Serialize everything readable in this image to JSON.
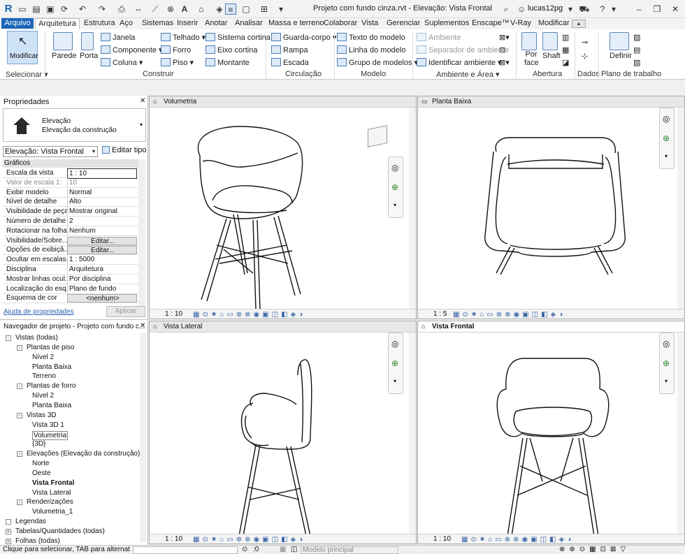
{
  "app": {
    "title": "Projeto com fundo cinza.rvt - Elevação: Vista Frontal",
    "user": "lucas12pg"
  },
  "menu": [
    "Arquivo",
    "Arquitetura",
    "Estrutura",
    "Aço",
    "Sistemas",
    "Inserir",
    "Anotar",
    "Analisar",
    "Massa e terreno",
    "Colaborar",
    "Vista",
    "Gerenciar",
    "Suplementos",
    "Enscape™",
    "V-Ray",
    "Modificar"
  ],
  "ribbon": {
    "modify": "Modificar",
    "select_group": "Selecionar",
    "wall": "Parede",
    "door": "Porta",
    "window": "Janela",
    "component": "Componente",
    "column": "Coluna",
    "roof": "Telhado",
    "ceiling": "Forro",
    "floor": "Piso",
    "curtain_system": "Sistema cortina",
    "curtain_grid": "Eixo cortina",
    "mullion": "Montante",
    "railing": "Guarda-corpo",
    "ramp": "Rampa",
    "stair": "Escada",
    "model_text": "Texto do modelo",
    "model_line": "Linha do modelo",
    "model_group": "Grupo de modelos",
    "room": "Ambiente",
    "room_separator": "Separador de ambiente",
    "tag_room": "Identificar ambiente",
    "by_face": "Por face",
    "shaft": "Shaft",
    "set": "Definir",
    "groups": {
      "build": "Construir",
      "circulation": "Circulação",
      "model": "Modelo",
      "room_area": "Ambiente e Área",
      "opening": "Abertura",
      "datum": "Dados",
      "work_plane": "Plano de trabalho"
    }
  },
  "properties": {
    "title": "Propriedades",
    "type_line1": "Elevação",
    "type_line2": "Elevação da construção",
    "selector": "Elevação: Vista Frontal",
    "edit_type": "Editar tipo",
    "section": "Gráficos",
    "rows": [
      {
        "k": "Escala da vista",
        "v": "1 : 10"
      },
      {
        "k": "Valor de escala   1:",
        "v": "10"
      },
      {
        "k": "Exibir modelo",
        "v": "Normal"
      },
      {
        "k": "Nível de detalhe",
        "v": "Alto"
      },
      {
        "k": "Visibilidade de peças",
        "v": "Mostrar original"
      },
      {
        "k": "Número de detalhe",
        "v": "2"
      },
      {
        "k": "Rotacionar na folha",
        "v": "Nenhum"
      },
      {
        "k": "Visibilidade/Sobre...",
        "v": "Editar..."
      },
      {
        "k": "Opções de exibiçã...",
        "v": "Editar..."
      },
      {
        "k": "Ocultar em escalas...",
        "v": "1 : 5000"
      },
      {
        "k": "Disciplina",
        "v": "Arquitetura"
      },
      {
        "k": "Mostrar linhas ocul...",
        "v": "Por disciplina"
      },
      {
        "k": "Localização do esq...",
        "v": "Plano de fundo"
      },
      {
        "k": "Esquema de cor",
        "v": "<nenhum>"
      }
    ],
    "help_link": "Ajuda de propriedades",
    "apply": "Aplicar"
  },
  "navigator": {
    "title": "Navegador de projeto - Projeto com fundo c...",
    "items": [
      {
        "label": "Vistas (todas)",
        "level": 0,
        "toggle": "-"
      },
      {
        "label": "Plantas de piso",
        "level": 1,
        "toggle": "-"
      },
      {
        "label": "Nível 2",
        "level": 2
      },
      {
        "label": "Planta Baixa",
        "level": 2
      },
      {
        "label": "Terreno",
        "level": 2
      },
      {
        "label": "Plantas de forro",
        "level": 1,
        "toggle": "-"
      },
      {
        "label": "Nível 2",
        "level": 2
      },
      {
        "label": "Planta Baixa",
        "level": 2
      },
      {
        "label": "Vistas 3D",
        "level": 1,
        "toggle": "-"
      },
      {
        "label": "Vista 3D 1",
        "level": 2
      },
      {
        "label": "Volumetria",
        "level": 2,
        "selected": true
      },
      {
        "label": "{3D}",
        "level": 2
      },
      {
        "label": "Elevações (Elevação da construção)",
        "level": 1,
        "toggle": "-"
      },
      {
        "label": "Norte",
        "level": 2
      },
      {
        "label": "Oeste",
        "level": 2
      },
      {
        "label": "Vista Frontal",
        "level": 2,
        "bold": true
      },
      {
        "label": "Vista Lateral",
        "level": 2
      },
      {
        "label": "Renderizações",
        "level": 1,
        "toggle": "-"
      },
      {
        "label": "Volumetria_1",
        "level": 2
      },
      {
        "label": "Legendas",
        "level": 0,
        "toggle": ""
      },
      {
        "label": "Tabelas/Quantidades (todas)",
        "level": 0,
        "toggle": "+"
      },
      {
        "label": "Folhas (todas)",
        "level": 0,
        "toggle": "+"
      }
    ]
  },
  "viewports": {
    "v1": {
      "title": "Volumetria",
      "scale": "1 : 10"
    },
    "v2": {
      "title": "Planta Baixa",
      "scale": "1 : 5"
    },
    "v3": {
      "title": "Vista Lateral",
      "scale": "1 : 10"
    },
    "v4": {
      "title": "Vista Frontal",
      "scale": "1 : 10"
    }
  },
  "status": {
    "hint": "Clique para selecionar, TAB para alternat",
    "count": ":0",
    "model": "Modelo principal"
  }
}
